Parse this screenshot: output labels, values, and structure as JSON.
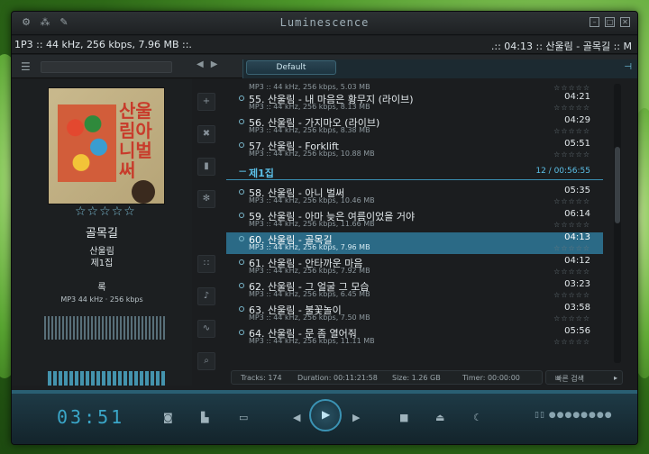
{
  "window": {
    "title": "Luminescence",
    "icons": [
      "gear-icon",
      "share-icon",
      "wrench-icon"
    ],
    "controls": [
      "minimize",
      "maximize",
      "close"
    ]
  },
  "infobar": {
    "left": "1P3 :: 44 kHz, 256 kbps, 7.96 MB ::.",
    "right": ".:: 04:13 :: 산울림 - 골목길 :: M"
  },
  "toolbar": {
    "tab_label": "Default"
  },
  "now_playing": {
    "title": "골목길",
    "artist": "산울림",
    "album": "제1집",
    "genre": "록",
    "format": "MP3  44 kHz · 256 kbps",
    "rating": "☆☆☆☆☆",
    "cover_lettering": "산울림아니벌써"
  },
  "playlist": {
    "rows_before": [
      {
        "info": "MP3 :: 44 kHz, 256 kbps, 5.03 MB"
      },
      {
        "title": "55. 산울림 - 내 마음은 황무지 (라이브)",
        "duration": "04:21",
        "info": "MP3 :: 44 kHz, 256 kbps, 8.13 MB"
      },
      {
        "title": "56. 산울림 - 가지마오 (라이브)",
        "duration": "04:29",
        "info": "MP3 :: 44 kHz, 256 kbps, 8.38 MB"
      },
      {
        "title": "57. 산울림 - Forklift",
        "duration": "05:51",
        "info": "MP3 :: 44 kHz, 256 kbps, 10.88 MB"
      }
    ],
    "group": {
      "name": "제1집",
      "right": "12 / 00:56:55"
    },
    "rows": [
      {
        "title": "58. 산울림 - 아니 벌써",
        "duration": "05:35",
        "info": "MP3 :: 44 kHz, 256 kbps, 10.46 MB"
      },
      {
        "title": "59. 산울림 - 아마 늦은 여름이었을 거야",
        "duration": "06:14",
        "info": "MP3 :: 44 kHz, 256 kbps, 11.66 MB"
      },
      {
        "title": "60. 산울림 - 골목길",
        "duration": "04:13",
        "info": "MP3 :: 44 kHz, 256 kbps, 7.96 MB"
      },
      {
        "title": "61. 산울림 - 안타까운 마음",
        "duration": "04:12",
        "info": "MP3 :: 44 kHz, 256 kbps, 7.92 MB"
      },
      {
        "title": "62. 산울림 - 그 얼굴 그 모습",
        "duration": "03:23",
        "info": "MP3 :: 44 kHz, 256 kbps, 6.45 MB"
      },
      {
        "title": "63. 산울림 - 불꽃놀이",
        "duration": "03:58",
        "info": "MP3 :: 44 kHz, 256 kbps, 7.50 MB"
      },
      {
        "title": "64. 산울림 - 문 좀 열어줘",
        "duration": "05:56",
        "info": "MP3 :: 44 kHz, 256 kbps, 11.11 MB"
      }
    ],
    "stars": "☆☆☆☆☆"
  },
  "status": {
    "tracks": "Tracks:  174",
    "duration": "Duration:  00:11:21:58",
    "size": "Size:  1.26 GB",
    "timer": "Timer:  00:00:00"
  },
  "quick_search": {
    "label": "빠른 검색",
    "arrow": "▸"
  },
  "player": {
    "time": "03:51",
    "volume_dots": "▯▯ ●●●●●●●●"
  },
  "colors": {
    "accent": "#3aa6c8",
    "selection": "#2b6a86"
  }
}
